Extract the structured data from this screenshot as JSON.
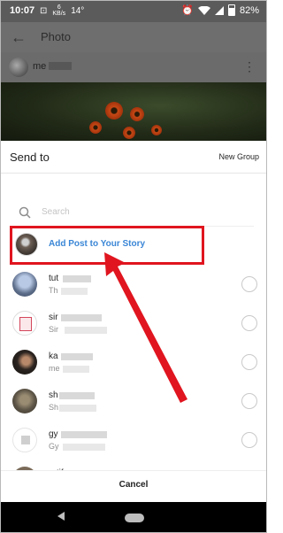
{
  "status_bar": {
    "time": "10:07",
    "network_speed_value": "6",
    "network_speed_unit": "KB/s",
    "temperature": "14°",
    "battery": "82%"
  },
  "app_bar": {
    "title": "Photo"
  },
  "post_user": {
    "name_prefix": "me"
  },
  "sheet": {
    "title": "Send to",
    "new_group_label": "New Group",
    "search": {
      "placeholder": "Search",
      "value": ""
    },
    "story_label": "Add Post to Your Story",
    "contacts": [
      {
        "name": "tut",
        "sub": "Th"
      },
      {
        "name": "sir",
        "sub": "Sir"
      },
      {
        "name": "ka",
        "sub": "me"
      },
      {
        "name": "sh",
        "sub": "Sh"
      },
      {
        "name": "gy",
        "sub": "Gy"
      },
      {
        "name": "ratif",
        "sub": ""
      }
    ],
    "cancel_label": "Cancel"
  },
  "colors": {
    "highlight_border": "#e0151f",
    "story_link": "#3a86d6",
    "arrow": "#e0151f"
  },
  "icons": [
    "back-arrow-icon",
    "more-icon",
    "search-icon",
    "wifi-icon",
    "battery-icon",
    "alarm-icon",
    "radio-button-icon",
    "nav-back-icon",
    "nav-home-icon"
  ]
}
